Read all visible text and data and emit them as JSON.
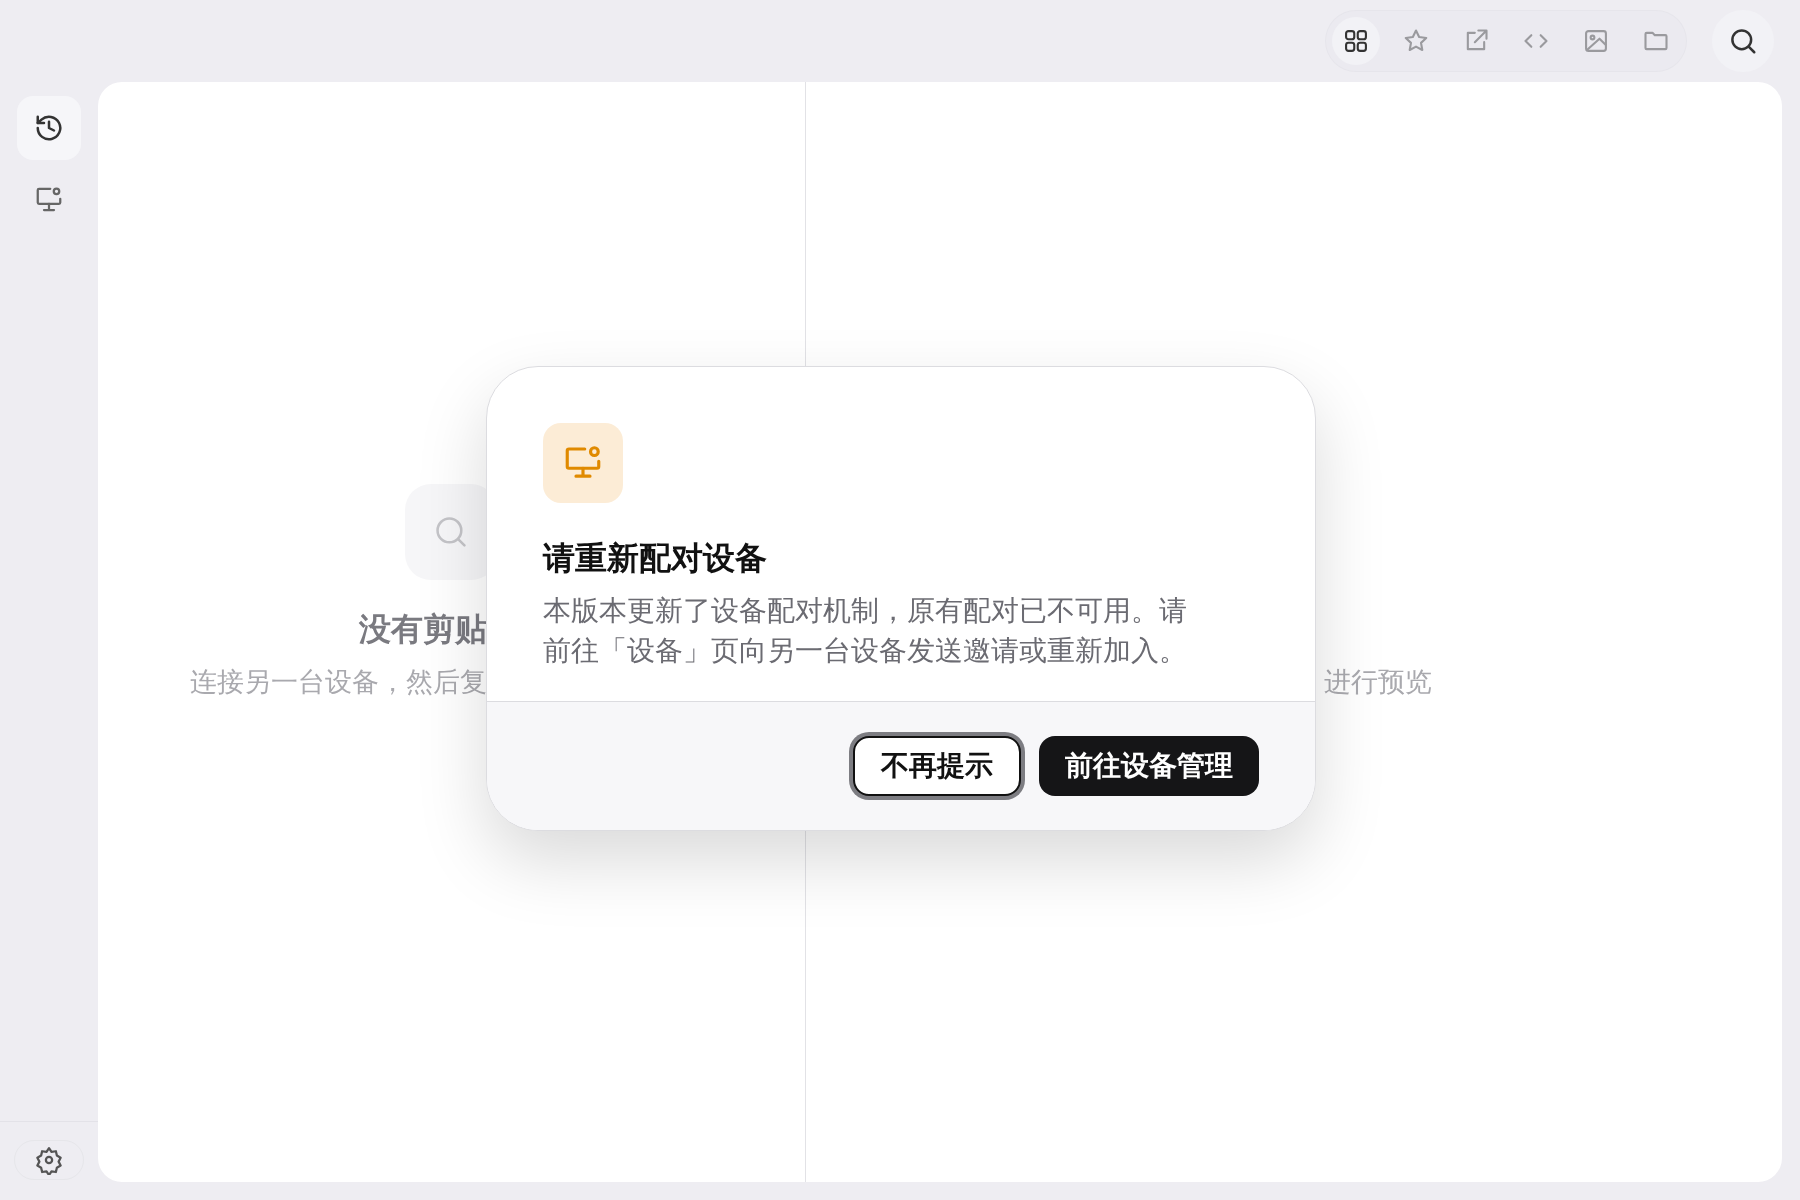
{
  "toolbar": {
    "items": [
      {
        "kind": "grid",
        "selected": true
      },
      {
        "kind": "star",
        "selected": false
      },
      {
        "kind": "external",
        "selected": false
      },
      {
        "kind": "code",
        "selected": false
      },
      {
        "kind": "image",
        "selected": false
      },
      {
        "kind": "folder",
        "selected": false
      }
    ]
  },
  "sidebar": {
    "items": [
      {
        "kind": "history",
        "selected": true
      },
      {
        "kind": "devices",
        "selected": false
      }
    ]
  },
  "left_panel": {
    "title": "没有剪贴",
    "subtitle": "连接另一台设备，然后复"
  },
  "right_panel": {
    "subtitle": "进行预览"
  },
  "dialog": {
    "title": "请重新配对设备",
    "body": "本版本更新了设备配对机制，原有配对已不可用。请前往「设备」页向另一台设备发送邀请或重新加入。",
    "buttons": [
      {
        "label": "不再提示",
        "kind": "secondary",
        "focused": true
      },
      {
        "label": "前往设备管理",
        "kind": "primary",
        "focused": false
      }
    ]
  }
}
